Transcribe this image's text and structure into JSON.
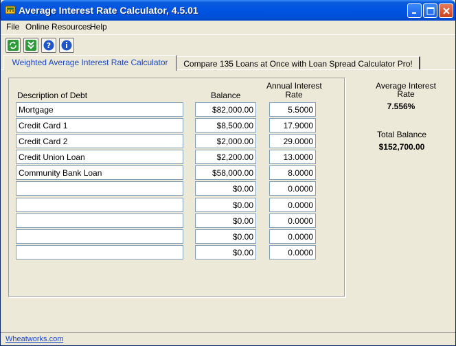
{
  "window": {
    "title": "Average Interest Rate Calculator, 4.5.01"
  },
  "menu": {
    "items": [
      "File",
      "Online Resources",
      "Help"
    ]
  },
  "toolbar": {
    "buttons": [
      "refresh-icon",
      "download-icon",
      "help-icon",
      "info-icon"
    ]
  },
  "tabs": {
    "active": "Weighted Average Interest Rate Calculator",
    "inactive": "Compare 135 Loans at Once with Loan Spread Calculator Pro!"
  },
  "table": {
    "headers": {
      "description": "Description of Debt",
      "balance": "Balance",
      "rate_line1": "Annual Interest",
      "rate_line2": "Rate"
    },
    "rows": [
      {
        "description": "Mortgage",
        "balance": "$82,000.00",
        "rate": "5.5000"
      },
      {
        "description": "Credit Card 1",
        "balance": "$8,500.00",
        "rate": "17.9000"
      },
      {
        "description": "Credit Card 2",
        "balance": "$2,000.00",
        "rate": "29.0000"
      },
      {
        "description": "Credit Union Loan",
        "balance": "$2,200.00",
        "rate": "13.0000"
      },
      {
        "description": "Community Bank Loan",
        "balance": "$58,000.00",
        "rate": "8.0000"
      },
      {
        "description": "",
        "balance": "$0.00",
        "rate": "0.0000"
      },
      {
        "description": "",
        "balance": "$0.00",
        "rate": "0.0000"
      },
      {
        "description": "",
        "balance": "$0.00",
        "rate": "0.0000"
      },
      {
        "description": "",
        "balance": "$0.00",
        "rate": "0.0000"
      },
      {
        "description": "",
        "balance": "$0.00",
        "rate": "0.0000"
      }
    ]
  },
  "results": {
    "avg_label_line1": "Average Interest",
    "avg_label_line2": "Rate",
    "avg_value": "7.556%",
    "total_label": "Total Balance",
    "total_value": "$152,700.00"
  },
  "status": {
    "link": "Wheatworks.com"
  },
  "colors": {
    "titlebar": "#0054E3",
    "active_tab_text": "#1A47C9",
    "link": "#1A47C9"
  }
}
